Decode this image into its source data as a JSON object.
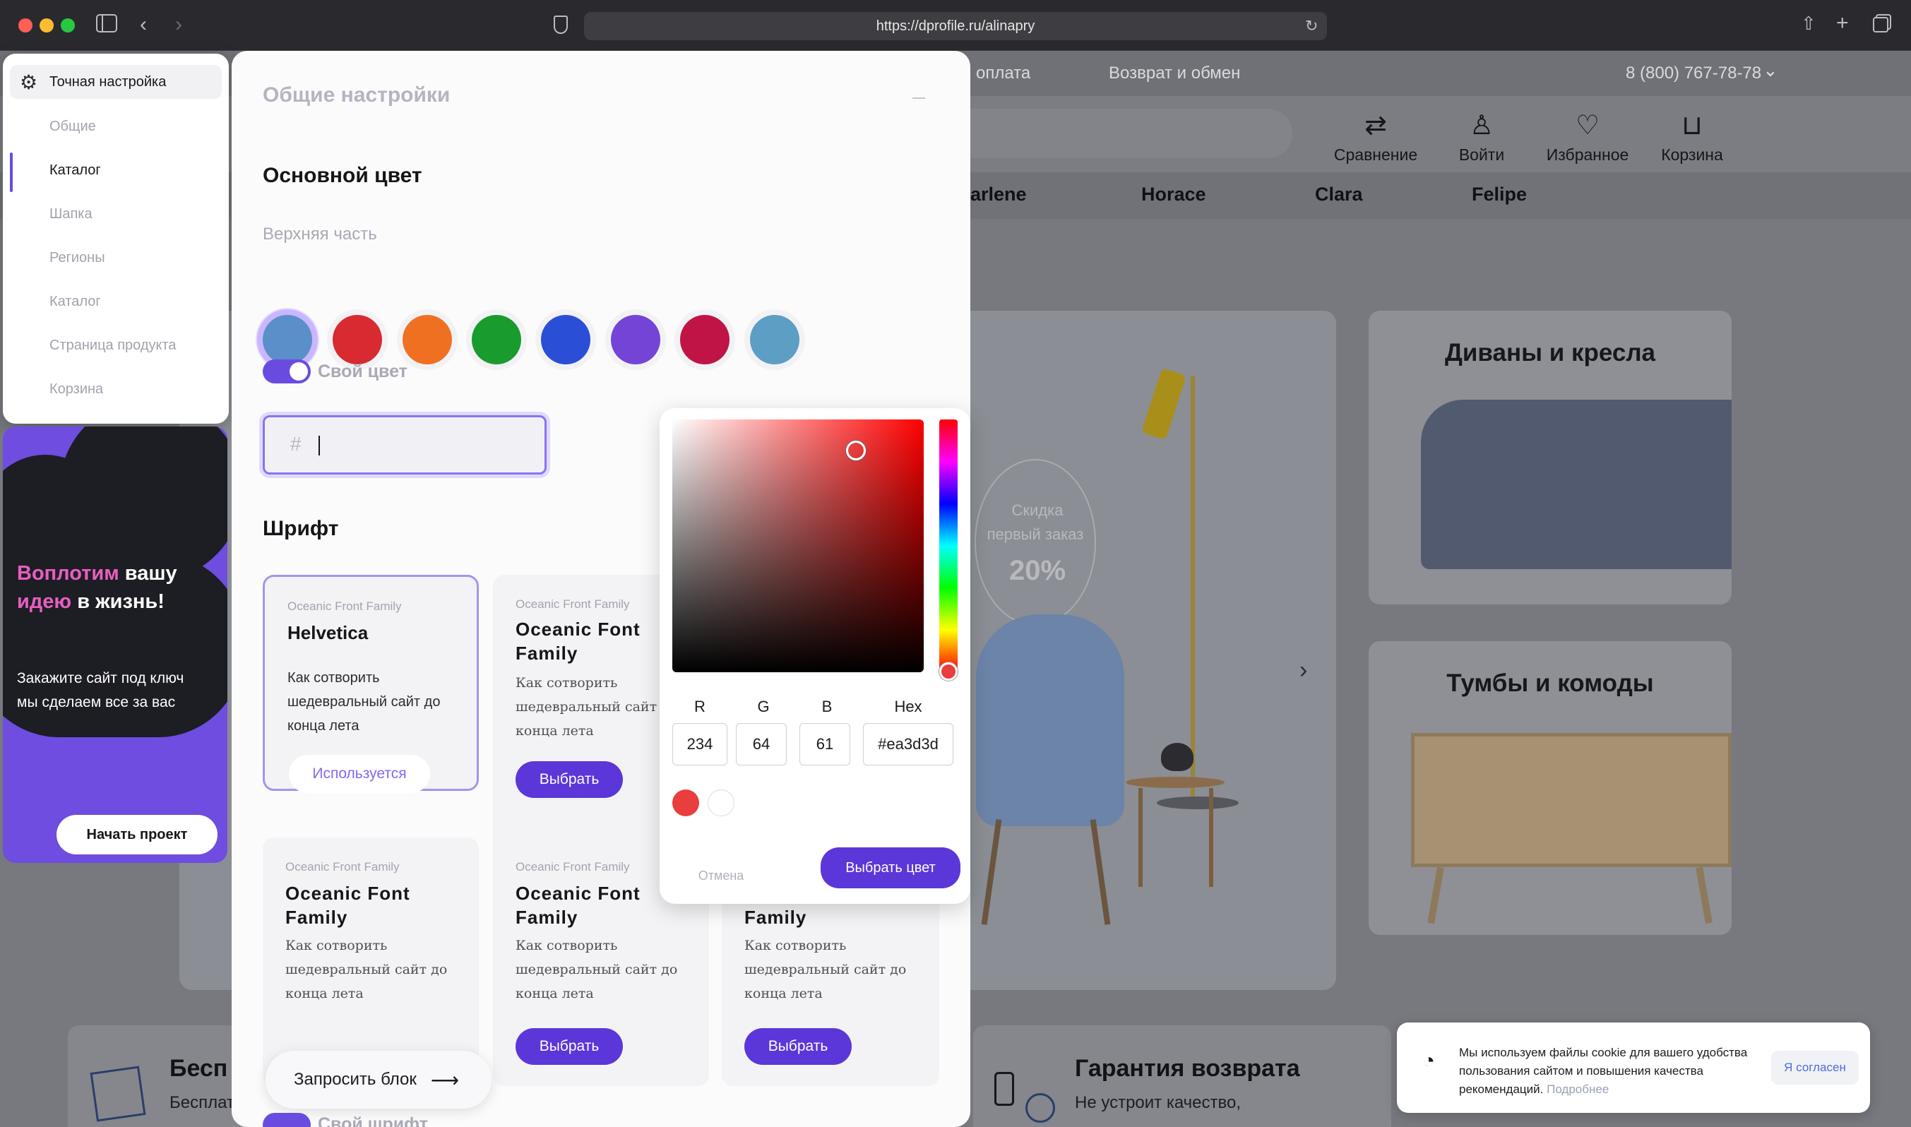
{
  "browser": {
    "url": "https://dprofile.ru/alinapry"
  },
  "site": {
    "top_links": [
      "оплата",
      "Возврат и обмен"
    ],
    "phone": "8 (800) 767-78-78",
    "header_icons": [
      {
        "label": "Сравнение",
        "icon": "compare-icon"
      },
      {
        "label": "Войти",
        "icon": "user-icon"
      },
      {
        "label": "Избранное",
        "icon": "heart-icon"
      },
      {
        "label": "Корзина",
        "icon": "basket-icon"
      }
    ],
    "nav": [
      "arlene",
      "Horace",
      "Clara",
      "Felipe"
    ],
    "promo_circle": {
      "line1": "Скидка",
      "line2": "первый заказ",
      "value": "20%"
    },
    "categories": [
      "Диваны и кресла",
      "Тумбы и комоды"
    ],
    "features": [
      {
        "title": "Бесп",
        "sub": "Бесплат"
      },
      {
        "title": "Гарантия возврата",
        "sub": "Не устроит качество,"
      }
    ],
    "cookie": {
      "text": "Мы используем файлы cookie для вашего удобства пользования сайтом и повышения качества рекомендаций.",
      "more": "Подробнее",
      "accept": "Я согласен"
    }
  },
  "settings_panel": {
    "title": "Точная настройка",
    "items": [
      "Общие",
      "Каталог",
      "Шапка",
      "Регионы",
      "Каталог",
      "Страница продукта",
      "Корзина"
    ],
    "active_index": 1
  },
  "promo": {
    "title_accent1": "Воплотим",
    "title_plain1": " вашу",
    "title_accent2": "идею",
    "title_plain2": " в жизнь!",
    "text": "Закажите сайт под ключ мы сделаем все за вас",
    "button": "Начать проект"
  },
  "modal": {
    "title": "Общие настройки",
    "main_color_heading": "Основной цвет",
    "top_part_label": "Верхняя часть",
    "swatches": [
      "#5b8fc9",
      "#d82a30",
      "#f07022",
      "#1a9b2e",
      "#2a4fd6",
      "#7444d6",
      "#c01447",
      "#5d9ec4"
    ],
    "custom_color_label": "Свой цвет",
    "custom_color_on": true,
    "hex_input_prefix": "#",
    "hex_input_value": "",
    "font_heading": "Шрифт",
    "font_cards": [
      {
        "sub": "Oceanic Front Family",
        "title": "Helvetica",
        "body": "Как сотворить шедевральный сайт до конца лета",
        "button": "Используется",
        "selected": true
      },
      {
        "sub": "Oceanic Front Family",
        "title": "Oceanic Font Family",
        "body": "Как сотворить шедевральный сайт до конца лета",
        "button": "Выбрать"
      },
      {
        "sub": "Oceanic Front Family",
        "title": "Oceanic Font Family",
        "body": "Как сотворить шедевральный сайт до конца лета",
        "button": ""
      },
      {
        "sub": "Oceanic Front Family",
        "title": "Oceanic Font Family",
        "body": "Как сотворить шедевральный сайт до конца лета",
        "button": "Выбрать"
      },
      {
        "sub": "",
        "title": "Family",
        "body": "Как сотворить шедевральный сайт до конца лета",
        "button": "Выбрать"
      }
    ],
    "request_block": "Запросить блок",
    "own_font_label": "Свой шрифт"
  },
  "color_picker": {
    "labels": {
      "r": "R",
      "g": "G",
      "b": "B",
      "hex": "Hex"
    },
    "r": "234",
    "g": "64",
    "b": "61",
    "hex": "#ea3d3d",
    "presets": [
      "#ea3d3d",
      "#ffffff"
    ],
    "cancel": "Отмена",
    "confirm": "Выбрать цвет"
  }
}
